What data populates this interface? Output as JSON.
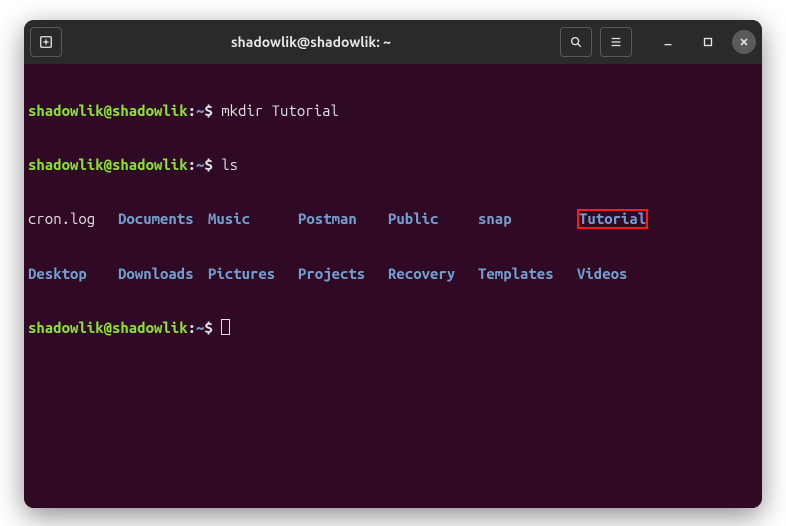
{
  "title": "shadowlik@shadowlik: ~",
  "prompt": {
    "user_host": "shadowlik@shadowlik",
    "colon": ":",
    "path": "~",
    "dollar": "$"
  },
  "commands": {
    "mkdir": " mkdir Tutorial",
    "ls": " ls",
    "empty": " "
  },
  "ls": {
    "row1": [
      "cron.log",
      "Documents",
      "Music",
      "Postman",
      "Public",
      "snap",
      "Tutorial"
    ],
    "row2": [
      "Desktop",
      "Downloads",
      "Pictures",
      "Projects",
      "Recovery",
      "Templates",
      "Videos"
    ]
  }
}
